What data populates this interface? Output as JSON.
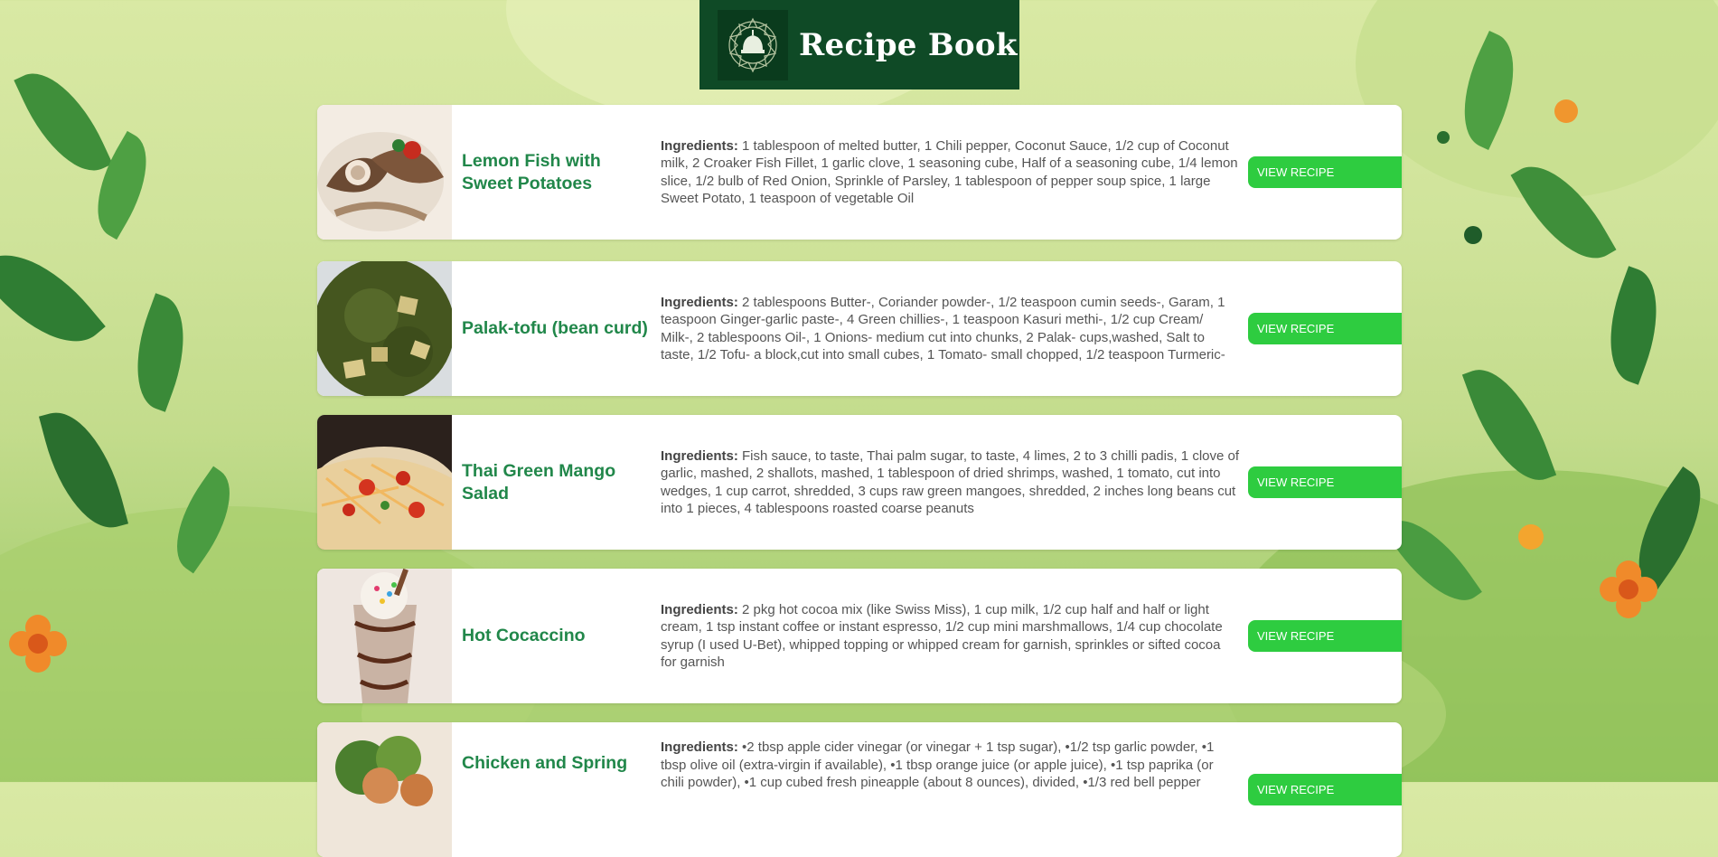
{
  "header": {
    "title": "Recipe Book",
    "logo": "mosque-dome-logo"
  },
  "recipes": [
    {
      "name": "Lemon Fish with Sweet Potatoes",
      "ingredients_label": "Ingredients:",
      "ingredients": "1 tablespoon of melted butter, 1 Chili pepper, Coconut Sauce, 1/2 cup of Coconut milk, 2 Croaker Fish Fillet, 1 garlic clove, 1 seasoning cube, Half of a seasoning cube, 1/4 lemon slice, 1/2 bulb of Red Onion, Sprinkle of Parsley, 1 tablespoon of pepper soup spice, 1 large Sweet Potato, 1 teaspoon of vegetable Oil",
      "button": "VIEW RECIPE"
    },
    {
      "name": "Palak-tofu (bean curd)",
      "ingredients_label": "Ingredients:",
      "ingredients": "2 tablespoons Butter-, Coriander powder-, 1/2 teaspoon cumin seeds-, Garam, 1 teaspoon Ginger-garlic paste-, 4 Green chillies-, 1 teaspoon Kasuri methi-, 1/2 cup Cream/ Milk-, 2 tablespoons Oil-, 1 Onions- medium cut into chunks, 2 Palak- cups,washed, Salt to taste, 1/2 Tofu- a block,cut into small cubes, 1 Tomato- small chopped, 1/2 teaspoon Turmeric-",
      "button": "VIEW RECIPE"
    },
    {
      "name": "Thai Green Mango Salad",
      "ingredients_label": "Ingredients:",
      "ingredients": "Fish sauce, to taste, Thai palm sugar, to taste, 4 limes, 2 to 3 chilli padis, 1 clove of garlic, mashed, 2 shallots, mashed, 1 tablespoon of dried shrimps, washed, 1 tomato, cut into wedges, 1 cup carrot, shredded, 3 cups raw green mangoes, shredded, 2 inches long beans cut into 1 pieces, 4 tablespoons roasted coarse peanuts",
      "button": "VIEW RECIPE"
    },
    {
      "name": "Hot Cocaccino",
      "ingredients_label": "Ingredients:",
      "ingredients": "2 pkg hot cocoa mix (like Swiss Miss), 1 cup milk, 1/2 cup half and half or light cream, 1 tsp instant coffee or instant espresso, 1/2 cup mini marshmallows, 1/4 cup chocolate syrup (I used U-Bet), whipped topping or whipped cream for garnish, sprinkles or sifted cocoa for garnish",
      "button": "VIEW RECIPE"
    },
    {
      "name": "Chicken and Spring",
      "ingredients_label": "Ingredients:",
      "ingredients": "•2 tbsp apple cider vinegar (or vinegar + 1 tsp sugar), •1/2 tsp garlic powder, •1 tbsp olive oil (extra-virgin if available), •1 tbsp orange juice (or apple juice), •1 tsp paprika (or chili powder), •1 cup cubed fresh pineapple (about 8 ounces), divided, •1/3 red bell pepper",
      "button": "VIEW RECIPE"
    }
  ]
}
